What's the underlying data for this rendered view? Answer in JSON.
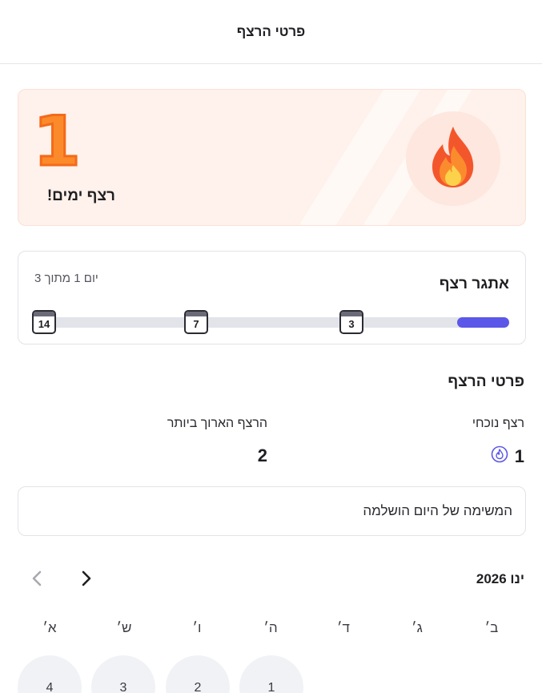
{
  "header": {
    "title": "פרטי הרצף"
  },
  "streak_card": {
    "count": "1",
    "label": "רצף ימים!",
    "icon": "flame-icon"
  },
  "challenge": {
    "title": "אתגר רצף",
    "progress_text": "יום 1 מתוך 3",
    "progress_fraction": 0.11,
    "milestones": [
      "3",
      "7",
      "14"
    ],
    "accent_color": "#5b57e8"
  },
  "details": {
    "title": "פרטי הרצף",
    "current_label": "רצף נוכחי",
    "current_value": "1",
    "longest_label": "הרצף הארוך ביותר",
    "longest_value": "2",
    "task_status": "המשימה של היום הושלמה"
  },
  "calendar": {
    "month": "ינו 2026",
    "weekdays": [
      "ב׳",
      "ג׳",
      "ד׳",
      "ה׳",
      "ו׳",
      "ש׳",
      "א׳"
    ],
    "days": [
      "1",
      "2",
      "3",
      "4"
    ]
  }
}
